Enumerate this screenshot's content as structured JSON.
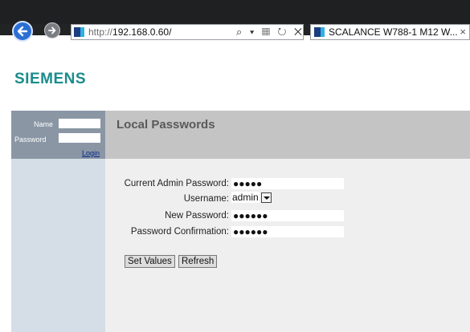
{
  "browser": {
    "url_prefix": "http://",
    "url_host": "192.168.0.60/",
    "address_icons": "⌕ ▾ ▦ ↻ ✕",
    "tab_title": "SCALANCE W788-1 M12 W...",
    "tab_close": "×"
  },
  "brand": {
    "logo_text": "SIEMENS",
    "logo_color": "#1a8c8c"
  },
  "login": {
    "name_label": "Name",
    "password_label": "Password",
    "login_link": "Login"
  },
  "page": {
    "title": "Local Passwords"
  },
  "form": {
    "fields": [
      {
        "label": "Current Admin Password:",
        "value": "●●●●●"
      },
      {
        "label": "Username:",
        "value": "admin"
      },
      {
        "label": "New Password:",
        "value": "●●●●●●"
      },
      {
        "label": "Password Confirmation:",
        "value": "●●●●●●"
      }
    ],
    "buttons": {
      "set_values": "Set Values",
      "refresh": "Refresh"
    }
  }
}
